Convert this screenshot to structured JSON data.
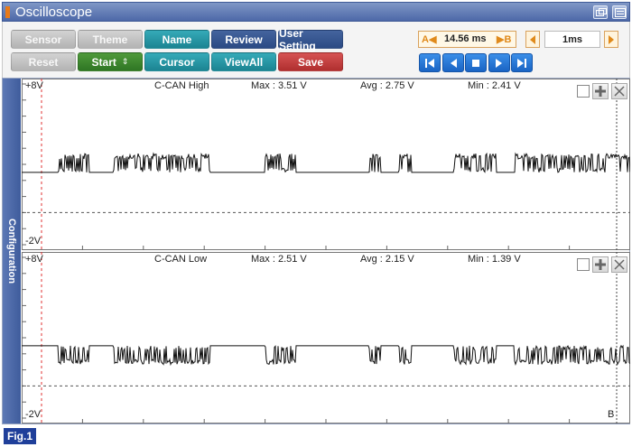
{
  "window": {
    "title": "Oscilloscope"
  },
  "toolbar": {
    "row1": [
      {
        "name": "sensor-button",
        "label": "Sensor",
        "style": "grey",
        "interactable": true
      },
      {
        "name": "theme-button",
        "label": "Theme",
        "style": "grey",
        "interactable": true
      },
      {
        "name": "name-button",
        "label": "Name",
        "style": "teal",
        "interactable": true
      },
      {
        "name": "review-button",
        "label": "Review",
        "style": "navy",
        "interactable": true
      },
      {
        "name": "user-setting-button",
        "label": "User Setting",
        "style": "navy",
        "interactable": true
      }
    ],
    "row2": [
      {
        "name": "reset-button",
        "label": "Reset",
        "style": "grey",
        "interactable": true
      },
      {
        "name": "start-button",
        "label": "Start",
        "style": "green",
        "spinner": true,
        "interactable": true
      },
      {
        "name": "cursor-button",
        "label": "Cursor",
        "style": "teal",
        "interactable": true
      },
      {
        "name": "viewall-button",
        "label": "ViewAll",
        "style": "teal",
        "interactable": true
      },
      {
        "name": "save-button",
        "label": "Save",
        "style": "red",
        "interactable": true
      }
    ],
    "cursor_time": {
      "label_a": "A◀",
      "value": "14.56 ms",
      "label_b": "▶B"
    },
    "time_scale": "1ms",
    "playback": [
      "skip-to-start-icon",
      "step-back-icon",
      "stop-icon",
      "step-forward-icon",
      "skip-to-end-icon"
    ]
  },
  "sidebar": {
    "label": "Configuration"
  },
  "channels": [
    {
      "top_label": "+8V",
      "bottom_label": "-2V",
      "name": "C-CAN High",
      "max": "Max : 3.51 V",
      "avg": "Avg : 2.75 V",
      "min": "Min : 2.41 V",
      "signal": {
        "baseline_volts": 2.5,
        "dominant_volts": 3.5,
        "ref_volts": 0
      },
      "end_marker": ""
    },
    {
      "top_label": "+8V",
      "bottom_label": "-2V",
      "name": "C-CAN Low",
      "max": "Max : 2.51 V",
      "avg": "Avg : 2.15 V",
      "min": "Min : 1.39 V",
      "signal": {
        "baseline_volts": 2.5,
        "dominant_volts": 1.5,
        "ref_volts": 0
      },
      "end_marker": "B"
    }
  ],
  "colors": {
    "cursor_a": "#e03030",
    "cursor_b": "#444444",
    "trace": "#111111",
    "accent": "#3f5c9c"
  },
  "figure_label": "Fig.1"
}
